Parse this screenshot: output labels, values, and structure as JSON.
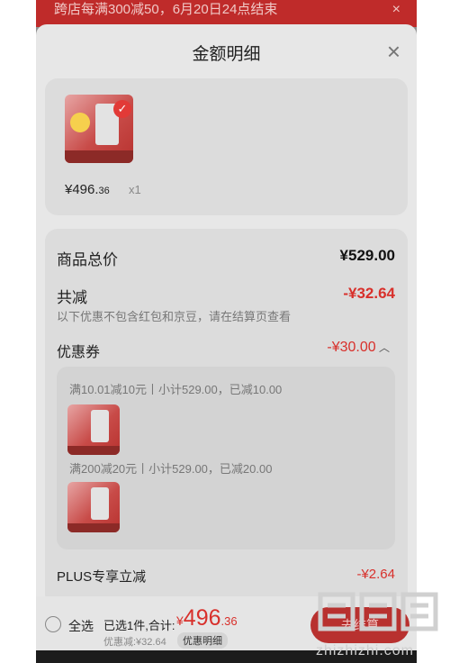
{
  "promo_banner": {
    "text": "跨店每满300减50，6月20日24点结束",
    "close_symbol": "×"
  },
  "sheet": {
    "title": "金额明细",
    "close_symbol": "×"
  },
  "item": {
    "price_main": "¥496.",
    "price_decimal": "36",
    "qty": "x1"
  },
  "rows": {
    "total_label": "商品总价",
    "total_value": "¥529.00",
    "reduce_label": "共减",
    "reduce_value": "-¥32.64",
    "reduce_note": "以下优惠不包含红包和京豆，请在结算页查看",
    "coupon_label": "优惠券",
    "coupon_value": "-¥30.00",
    "coupon_lines": [
      "满10.01减10元丨小计529.00，已减10.00",
      "满200减20元丨小计529.00，已减20.00"
    ],
    "plus_label": "PLUS专享立减",
    "plus_value": "-¥2.64"
  },
  "footer": {
    "select_all": "全选",
    "summary": "已选1件,合计:",
    "total_currency": "¥",
    "total_int": "496",
    "total_dec": ".36",
    "discount": "优惠减:¥32.64",
    "detail_button": "优惠明细",
    "checkout_button": "去结算"
  },
  "watermark": {
    "logo": "值值值",
    "text": "zhizhizhi.com"
  },
  "colors": {
    "accent": "#d8302b",
    "banner": "#bf2b2a"
  }
}
